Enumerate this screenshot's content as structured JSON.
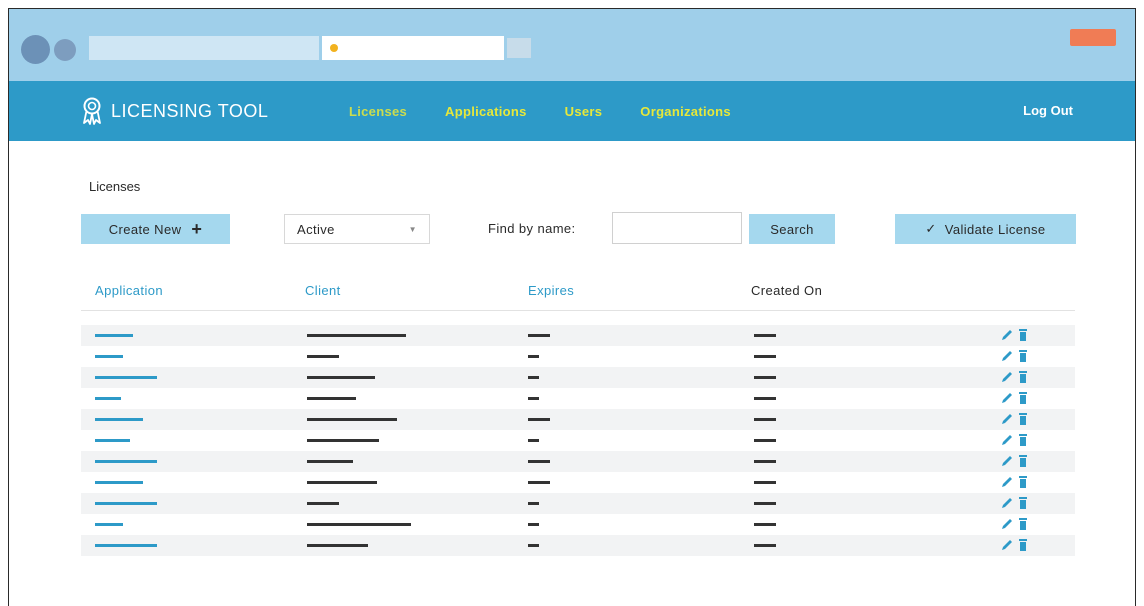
{
  "nav": {
    "brand": "LICENSING TOOL",
    "links": [
      "Licenses",
      "Applications",
      "Users",
      "Organizations"
    ],
    "logout": "Log Out"
  },
  "page": {
    "title": "Licenses",
    "create_label": "Create New",
    "filter_value": "Active",
    "find_label": "Find by name:",
    "search_label": "Search",
    "validate_label": "Validate License"
  },
  "table": {
    "headers": [
      "Application",
      "Client",
      "Expires",
      "Created On"
    ],
    "rows": [
      {
        "application": 0.47,
        "client": 0.95,
        "expires": 0.47,
        "created": 0.47
      },
      {
        "application": 0.35,
        "client": 0.31,
        "expires": 0.23,
        "created": 0.47
      },
      {
        "application": 0.78,
        "client": 0.65,
        "expires": 0.23,
        "created": 0.47
      },
      {
        "application": 0.32,
        "client": 0.47,
        "expires": 0.23,
        "created": 0.47
      },
      {
        "application": 0.6,
        "client": 0.87,
        "expires": 0.47,
        "created": 0.47
      },
      {
        "application": 0.44,
        "client": 0.69,
        "expires": 0.23,
        "created": 0.47
      },
      {
        "application": 0.78,
        "client": 0.44,
        "expires": 0.47,
        "created": 0.47
      },
      {
        "application": 0.6,
        "client": 0.67,
        "expires": 0.47,
        "created": 0.47
      },
      {
        "application": 0.78,
        "client": 0.31,
        "expires": 0.23,
        "created": 0.47
      },
      {
        "application": 0.35,
        "client": 1.0,
        "expires": 0.23,
        "created": 0.47
      },
      {
        "application": 0.78,
        "client": 0.59,
        "expires": 0.23,
        "created": 0.47
      }
    ]
  },
  "colors": {
    "navbar": "#2d9ac8",
    "nav_link": "#e7e83a",
    "button": "#a5d8ee",
    "link": "#2d9ac8",
    "close_button": "#f07c55"
  },
  "icons": [
    "award-icon",
    "plus-icon",
    "chevron-down-icon",
    "check-icon",
    "pencil-icon",
    "trash-icon"
  ]
}
